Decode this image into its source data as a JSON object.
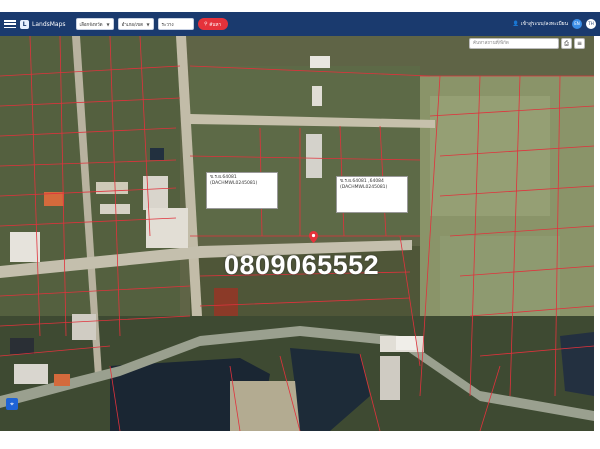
{
  "header": {
    "app_name": "LandsMaps",
    "province_select": "เลือกจังหวัด",
    "district_select": "อำเภอ/เขต",
    "parcel_no": "ระวาง",
    "search_button": "ค้นหา",
    "login_label": "เข้าสู่ระบบ/ลงทะเบียน",
    "lang_en": "EN",
    "lang_th": "TH"
  },
  "map": {
    "search_placeholder": "ค้นหาสถานที่/พิกัด",
    "parcel_labels": [
      "ข.ร.ผ.64081 (DACHMWL0245081)",
      "ข.ร.ผ.64081 ,64084\n(DACHMWL0245081)"
    ],
    "phone_overlay": "0809065552"
  },
  "colors": {
    "header_bg": "#1a3a6e",
    "search_btn": "#e5323b",
    "parcel_line": "#e0323c",
    "accent_blue": "#1e63d6"
  },
  "icons": {
    "menu": "hamburger-icon",
    "search": "search-icon",
    "user": "user-icon",
    "layers": "layers-icon",
    "print": "print-icon",
    "location": "location-icon",
    "pin": "map-pin-icon"
  }
}
